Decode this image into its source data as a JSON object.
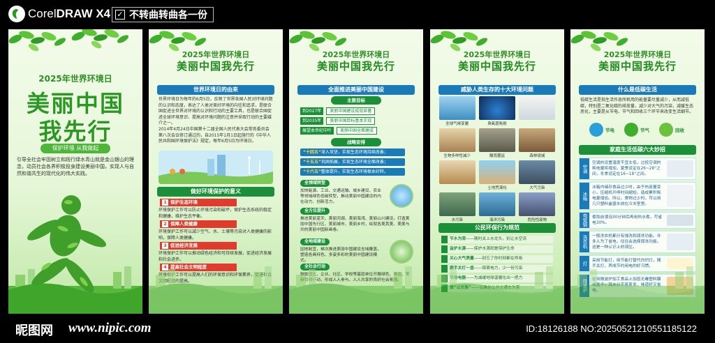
{
  "topbar": {
    "app_name_regular": "Corel",
    "app_name_bold": "DRAW",
    "app_version": "X4",
    "tag_check": "✓",
    "tag_text": "不转曲转曲各一份"
  },
  "panel1": {
    "year_title": "2025年世界环境日",
    "big_line1": "美丽中国",
    "big_line2": "我先行",
    "slogan": "保护环境 从我做起",
    "intro": "引导全社会牢固树立和践行绿水青山就是金山银山的理念，动员社会各界积极投身建设美丽中国，实现人与自然和谐共生的现代化的伟大实践。"
  },
  "panel2": {
    "year_title": "2025年世界环境日",
    "main_title": "美丽中国我先行",
    "section1": "世界环境日的由来",
    "para1": "世界环境日为每年的6月5日，反映了世界各国人民对环境问题的认识和态度，表达了人类对美好环境的向往和追求，是联合国促进全世界对环境的认识和行动的主要工具，也是联合国促进全球环境意识、提高对环境问题的注意并采取行动的主要媒介之一。",
    "para2": "2014年4月24日中国第十二届全国人民代表大会常务委员会第八次会议修订通过的，自2015年1月1日起施行的《中华人民共和国环境保护法》规定，每年6月5日为环境日。",
    "section2": "做好环境保护的意义",
    "items": [
      {
        "num": "1",
        "head": "保护生态环境",
        "text": "环境保护工作可以防止环境污染和破坏，保护生态系统的稳定和健康，维护生态平衡。"
      },
      {
        "num": "2",
        "head": "保障人类健康",
        "text": "环境保护工作可以减少空气、水、土壤等污染对人类健康的影响，保障人类健康。"
      },
      {
        "num": "3",
        "head": "促进经济发展",
        "text": "环境保护工作可以推动绿色经济和可持续发展，促进经济发展和社会进步。"
      },
      {
        "num": "4",
        "head": "提高社会文明程度",
        "text": "环境保护工作可以提高人们的环保意识和环保素养，促进社会文明程度的提高。"
      }
    ]
  },
  "panel3": {
    "year_title": "2025年世界环境日",
    "main_title": "美丽中国我先行",
    "section1": "全面推进美丽中国建设",
    "goal_head": "主要目标",
    "goals": [
      {
        "year": "到2027年",
        "text": "美丽中国建设成效显著"
      },
      {
        "year": "到2035年",
        "text": "美丽中国目标基本实现"
      },
      {
        "year": "展望本世纪中叶",
        "text": "美丽中国全面建成"
      }
    ],
    "plan_head": "战略安排",
    "plans": [
      {
        "hl": "“十四五”",
        "text": "深入攻坚，实现生态环境持续改善；"
      },
      {
        "hl": "“十五五”",
        "text": "巩固拓展，实现生态环境全面改善；"
      },
      {
        "hl": "“十六五”",
        "text": "整体提升，实现生态环境根本好转。"
      }
    ],
    "tags": [
      {
        "head": "全领域转型",
        "text": "加快能源、工业、交通运输、城乡建设、农业等领域绿色低碳转型，推动美丽中国建设的内在动力、创新活力。"
      },
      {
        "head": "全方位提升",
        "text": "推进美丽蓝天、美丽河湖、美丽海湾、美丽山川建设，打造美丽中国先行区、美丽城市、美丽乡村，绘就各美其美、美美与共的美丽中国新画卷。"
      },
      {
        "head": "全地域建设",
        "text": "因地制宜，梯次推进美丽中国建设全域覆盖，塑造各具特色、多姿多彩的美丽中国建设模式。"
      },
      {
        "head": "全社会行动",
        "text": "鼓励园区、企业、社区、学校等基层单位开展绿色、清洁、零碳引领行动，形成人人参与、人人共享的良好社会氛围。"
      }
    ]
  },
  "panel4": {
    "year_title": "2025年世界环境日",
    "main_title": "美丽中国我先行",
    "section1": "威胁人类生存的十大环境问题",
    "threats": [
      "全球气候变暖",
      "臭氧层耗损",
      "",
      "生物多样性减少",
      "酸雨蔓延",
      "森林锐减",
      "",
      "土地荒漠化",
      "大气污染",
      "水污染",
      "海洋污染",
      "危险性废物"
    ],
    "section2": "公民环保行为规范",
    "actions": [
      {
        "hl": "节水为荣",
        "text": "——随时关上水龙头，别让水空流"
      },
      {
        "hl": "监护水源",
        "text": "——保护水源就是保护生命"
      },
      {
        "hl": "关心大气质量",
        "text": "——别忘了你时刻都在呼吸"
      },
      {
        "hl": "跟手关灯一盏",
        "text": "——探索电力，少一份污染"
      },
      {
        "hl": "节用电器",
        "text": "——为减缓地球温暖化出一把力"
      },
      {
        "hl": "做“公交族”",
        "text": "——以乘坐公共交通车为荣"
      }
    ]
  },
  "panel5": {
    "year_title": "2025年世界环境日",
    "main_title": "美丽中国我先行",
    "section1": "什么是低碳生活",
    "para1": "低碳生活是指生活作息所耗用的能量要尽量减少，从而减低碳，特别是二氧化碳的排放量，减少对大气的污染，减缓生态恶化，主要是从节电、节气和回收三个环节来改变生活细节。",
    "icons": [
      "节电",
      "节气",
      "回收"
    ],
    "section2": "家庭生活低碳六大妙招",
    "tips": [
      {
        "label": "空调",
        "text": "空调的设置温度不宜太低，过低空调的耗电量将增加，夏季设定在26~28°之间，冬季设定在16~18°之间。"
      },
      {
        "label": "冰箱",
        "text": "冰箱内储存食品过少时，由于热容量变小，压缩机开停时间缩短，造成累积耗电量增加。所以，食物过少时，可以用几只塑料盒盛水放在冷冻室里。"
      },
      {
        "label": "电饭锅",
        "text": "煮饭前浸泡30分钟后再用热水煮，可省电30%。"
      },
      {
        "label": "洗衣机",
        "text": "一般洗衣机都分有强洗和弱洗功能。许多人为了省电，往往会选择弱洗功能，这是一种认识上的误区。"
      },
      {
        "label": "灯",
        "text": "采用节能灯，用节能灯替代白炽灯，随手关灯，养成节约用电的好习惯。"
      },
      {
        "label": "微波炉",
        "text": "在用微波炉加工食品上加层无毒塑料膜或盖子，其水分不易蒸发，味道好又省电。"
      }
    ]
  },
  "footer": {
    "site_cn": "昵图网",
    "site_url": "www.nipic.com",
    "id_text": "ID:18126188 NO:20250521210551185122"
  },
  "colors": {
    "green_dark": "#1c8f3a",
    "green_title": "#2a9a1f",
    "blue": "#1b7ab8",
    "red": "#e03b2d"
  }
}
